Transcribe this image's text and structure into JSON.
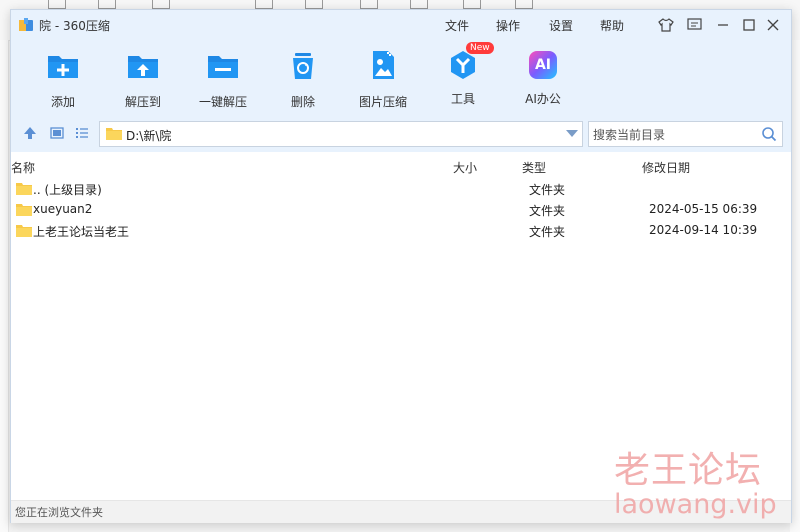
{
  "window": {
    "title": "院 - 360压缩",
    "menu": [
      "文件",
      "操作",
      "设置",
      "帮助"
    ]
  },
  "toolbar": {
    "items": [
      {
        "label": "添加",
        "icon": "add-icon"
      },
      {
        "label": "解压到",
        "icon": "extract-to-icon"
      },
      {
        "label": "一键解压",
        "icon": "one-click-extract-icon"
      },
      {
        "label": "删除",
        "icon": "delete-icon"
      },
      {
        "label": "图片压缩",
        "icon": "image-compress-icon"
      },
      {
        "label": "工具",
        "icon": "tools-icon",
        "badge": "New"
      },
      {
        "label": "AI办公",
        "icon": "ai-office-icon",
        "icon_text": "AI"
      }
    ]
  },
  "address": {
    "path": "D:\\新\\院",
    "search_placeholder": "搜索当前目录"
  },
  "columns": {
    "name": "名称",
    "size": "大小",
    "type": "类型",
    "modified": "修改日期"
  },
  "files": [
    {
      "name": ".. (上级目录)",
      "type": "文件夹",
      "modified": ""
    },
    {
      "name": "xueyuan2",
      "type": "文件夹",
      "modified": "2024-05-15 06:39"
    },
    {
      "name": "上老王论坛当老王",
      "type": "文件夹",
      "modified": "2024-09-14 10:39"
    }
  ],
  "status": "您正在浏览文件夹",
  "watermark": {
    "line1": "老王论坛",
    "line2": "laowang.vip"
  },
  "colors": {
    "accent": "#1e88e5",
    "folder": "#f7c948",
    "toolbar_bg": "#e8f2fd",
    "watermark": "#f0a3a3"
  }
}
